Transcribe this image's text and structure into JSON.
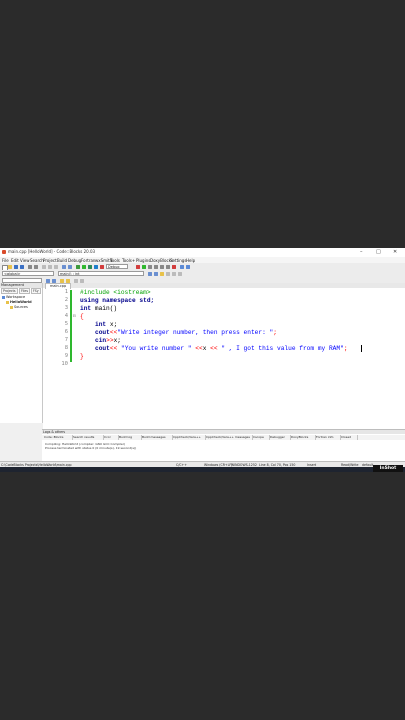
{
  "window": {
    "title": "main.cpp [HelloWorld] - Code::Blocks 20.03",
    "controls": [
      "–",
      "□",
      "✕"
    ]
  },
  "menu": [
    "File",
    "Edit",
    "View",
    "Search",
    "Project",
    "Build",
    "Debug",
    "Fortran",
    "wxSmith",
    "Tools",
    "Tools+",
    "Plugins",
    "DoxyBlocks",
    "Settings",
    "Help"
  ],
  "toolbar": {
    "scope_combo": "<global>",
    "target_combo": "Debug",
    "symbol_combo": "main() : int",
    "search_combo": ""
  },
  "management": {
    "title": "Management",
    "tabs": [
      "Projects",
      "Files",
      "FSy"
    ],
    "tree": {
      "workspace": "Workspace",
      "project": "HelloWorld",
      "folder": "Sources"
    }
  },
  "editor": {
    "tab_label": "main.cpp",
    "line_numbers": [
      "1",
      "2",
      "3",
      "4",
      "5",
      "6",
      "7",
      "8",
      "9",
      "10"
    ],
    "code": {
      "l1_include": "#include <iostream>",
      "l2_using": "using namespace std;",
      "l3_int": "int",
      "l3_main": " main()",
      "l4_brace": "{",
      "l5_int": "int",
      "l5_rest": " x;",
      "l6_cout": "cout",
      "l6_op": "<<",
      "l6_str": "\"Write integer number, then press enter: \"",
      "l6_end": ";",
      "l7_cin": "cin",
      "l7_op": ">>",
      "l7_rest": "x;",
      "l8_cout": "cout",
      "l8_op": "<< ",
      "l8_str1": "\"You write number \"",
      "l8_op2": " <<",
      "l8_x": "x",
      "l8_op3": " << ",
      "l8_str2": "\" , I got this value from my RAM\"",
      "l8_end": ";",
      "l9_brace": "}"
    }
  },
  "logs": {
    "title": "Logs & others",
    "tabs": [
      "Code::Blocks",
      "Search results",
      "Cccc",
      "Build log",
      "Build messages",
      "CppCheck/Vera++",
      "CppCheck/Vera++ messages",
      "Cscope",
      "Debugger",
      "DoxyBlocks",
      "Fortran info",
      "Closed"
    ],
    "messages": [
      "Compiling: HelloWorld (compiler: GNU GCC Compiler)",
      "Process terminated with status 0 (0 minute(s), 19 second(s))"
    ]
  },
  "status": {
    "path": "C:\\CodeBlocks Projects\\HelloWorld\\main.cpp",
    "lang": "C/C++",
    "eol": "Windows (CR+LF)",
    "encoding": "WINDOWS-1252",
    "position": "Line 8, Col 70, Pos 150",
    "mode": "Insert",
    "rw": "Read/Write",
    "profile": "default"
  },
  "watermark": "InShot",
  "colors": {
    "keyword": "#00008b",
    "preprocessor": "#00a000",
    "string": "#0000ff",
    "operator": "#ff0000",
    "change_bar": "#2eb82e"
  }
}
